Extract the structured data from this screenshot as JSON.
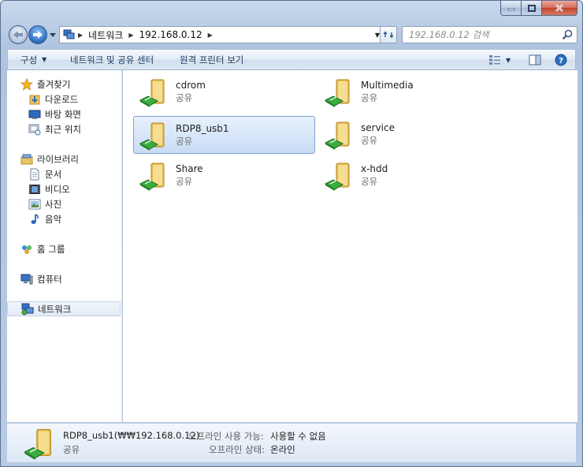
{
  "window": {
    "caption_buttons": [
      "minimize",
      "maximize",
      "close"
    ]
  },
  "address": {
    "crumbs": [
      "네트워크",
      "192.168.0.12"
    ],
    "search_placeholder": "192.168.0.12 검색"
  },
  "commandbar": {
    "organize": "구성",
    "network_center": "네트워크 및 공유 센터",
    "remote_printers": "원격 프린터 보기"
  },
  "nav": {
    "favorites": {
      "label": "즐겨찾기",
      "items": [
        "다운로드",
        "바탕 화면",
        "최근 위치"
      ]
    },
    "libraries": {
      "label": "라이브러리",
      "items": [
        "문서",
        "비디오",
        "사진",
        "음악"
      ]
    },
    "homegroup": "홈 그룹",
    "computer": "컴퓨터",
    "network": "네트워크"
  },
  "shares": [
    {
      "name": "cdrom",
      "type": "공유",
      "selected": false
    },
    {
      "name": "Multimedia",
      "type": "공유",
      "selected": false
    },
    {
      "name": "RDP8_usb1",
      "type": "공유",
      "selected": true
    },
    {
      "name": "service",
      "type": "공유",
      "selected": false
    },
    {
      "name": "Share",
      "type": "공유",
      "selected": false
    },
    {
      "name": "x-hdd",
      "type": "공유",
      "selected": false
    }
  ],
  "details": {
    "title": "RDP8_usb1(₩₩192.168.0.12)",
    "type": "공유",
    "offline_avail_label": "오프라인 사용 가능:",
    "offline_avail_value": "사용할 수 없음",
    "offline_status_label": "오프라인 상태:",
    "offline_status_value": "온라인"
  },
  "colors": {
    "accent": "#1e395b",
    "selection_fill": "#c8dcf5",
    "selection_border": "#7da2ce",
    "folder_yellow": "#f2d27a",
    "share_green": "#3cae3f"
  }
}
